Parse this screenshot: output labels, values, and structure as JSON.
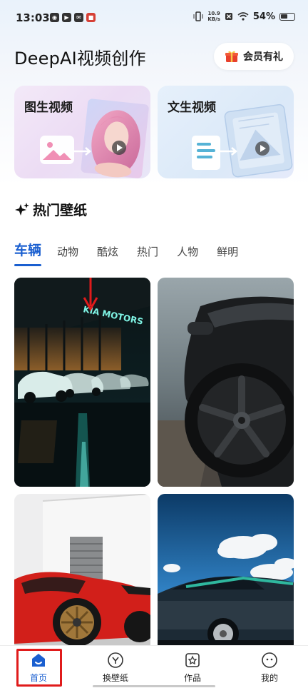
{
  "status_bar": {
    "time": "13:03",
    "network_speed": "10.9",
    "network_unit": "KB/s",
    "battery": "54%"
  },
  "header": {
    "title": "DeepAI视频创作",
    "member_label": "会员有礼"
  },
  "features": [
    {
      "title": "图生视频"
    },
    {
      "title": "文生视频"
    }
  ],
  "section": {
    "title": "热门壁纸"
  },
  "tabs": [
    "车辆",
    "动物",
    "酷炫",
    "热门",
    "人物",
    "鲜明"
  ],
  "active_tab": "车辆",
  "wallpapers": [
    {
      "sign_text": "KIA MOTORS"
    },
    {},
    {},
    {}
  ],
  "bottom_nav": [
    {
      "label": "首页"
    },
    {
      "label": "换壁纸"
    },
    {
      "label": "作品"
    },
    {
      "label": "我的"
    }
  ],
  "colors": {
    "accent": "#1a5fd0",
    "highlight_red": "#e01b1b"
  }
}
